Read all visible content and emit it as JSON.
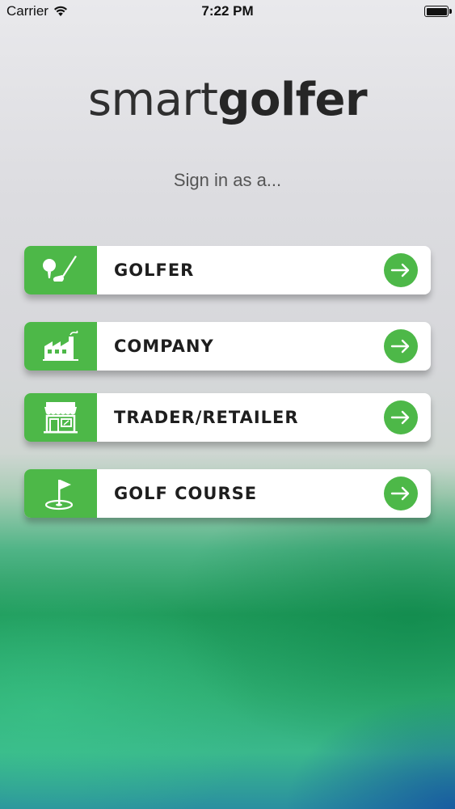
{
  "status_bar": {
    "carrier": "Carrier",
    "time": "7:22 PM"
  },
  "logo": {
    "light": "smart",
    "bold": "golfer"
  },
  "subtitle": "Sign in as a...",
  "options": [
    {
      "label": "GOLFER",
      "icon": "golf-ball-club-icon"
    },
    {
      "label": "COMPANY",
      "icon": "factory-icon"
    },
    {
      "label": "TRADER/RETAILER",
      "icon": "storefront-icon"
    },
    {
      "label": "GOLF COURSE",
      "icon": "golf-flag-icon"
    }
  ],
  "colors": {
    "accent_green": "#4db848",
    "text_dark": "#1e1e1e"
  }
}
